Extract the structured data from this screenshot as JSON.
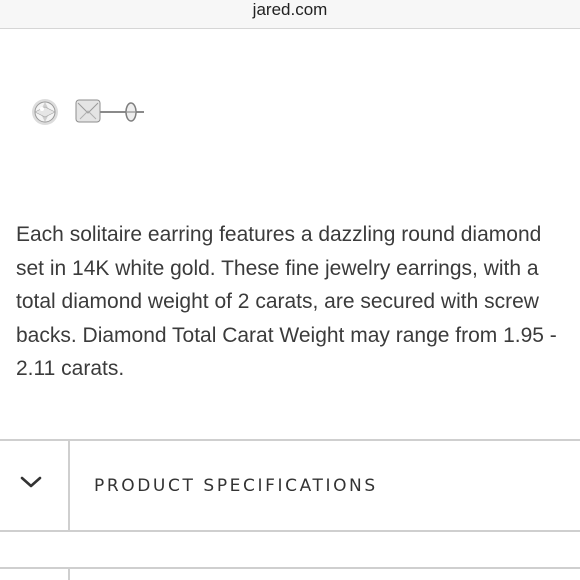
{
  "browser": {
    "url": "jared.com"
  },
  "product": {
    "thumbnails": [
      {
        "icon": "diamond-top-view-icon"
      },
      {
        "icon": "earring-side-view-icon"
      }
    ],
    "description": "Each solitaire earring features a dazzling round diamond set in 14K white gold. These fine jewelry earrings, with a total diamond weight of 2 carats, are secured with screw backs. Diamond Total Carat Weight may range from 1.95 - 2.11 carats."
  },
  "sections": [
    {
      "title": "PRODUCT SPECIFICATIONS",
      "icon": "chevron-down-icon"
    }
  ]
}
